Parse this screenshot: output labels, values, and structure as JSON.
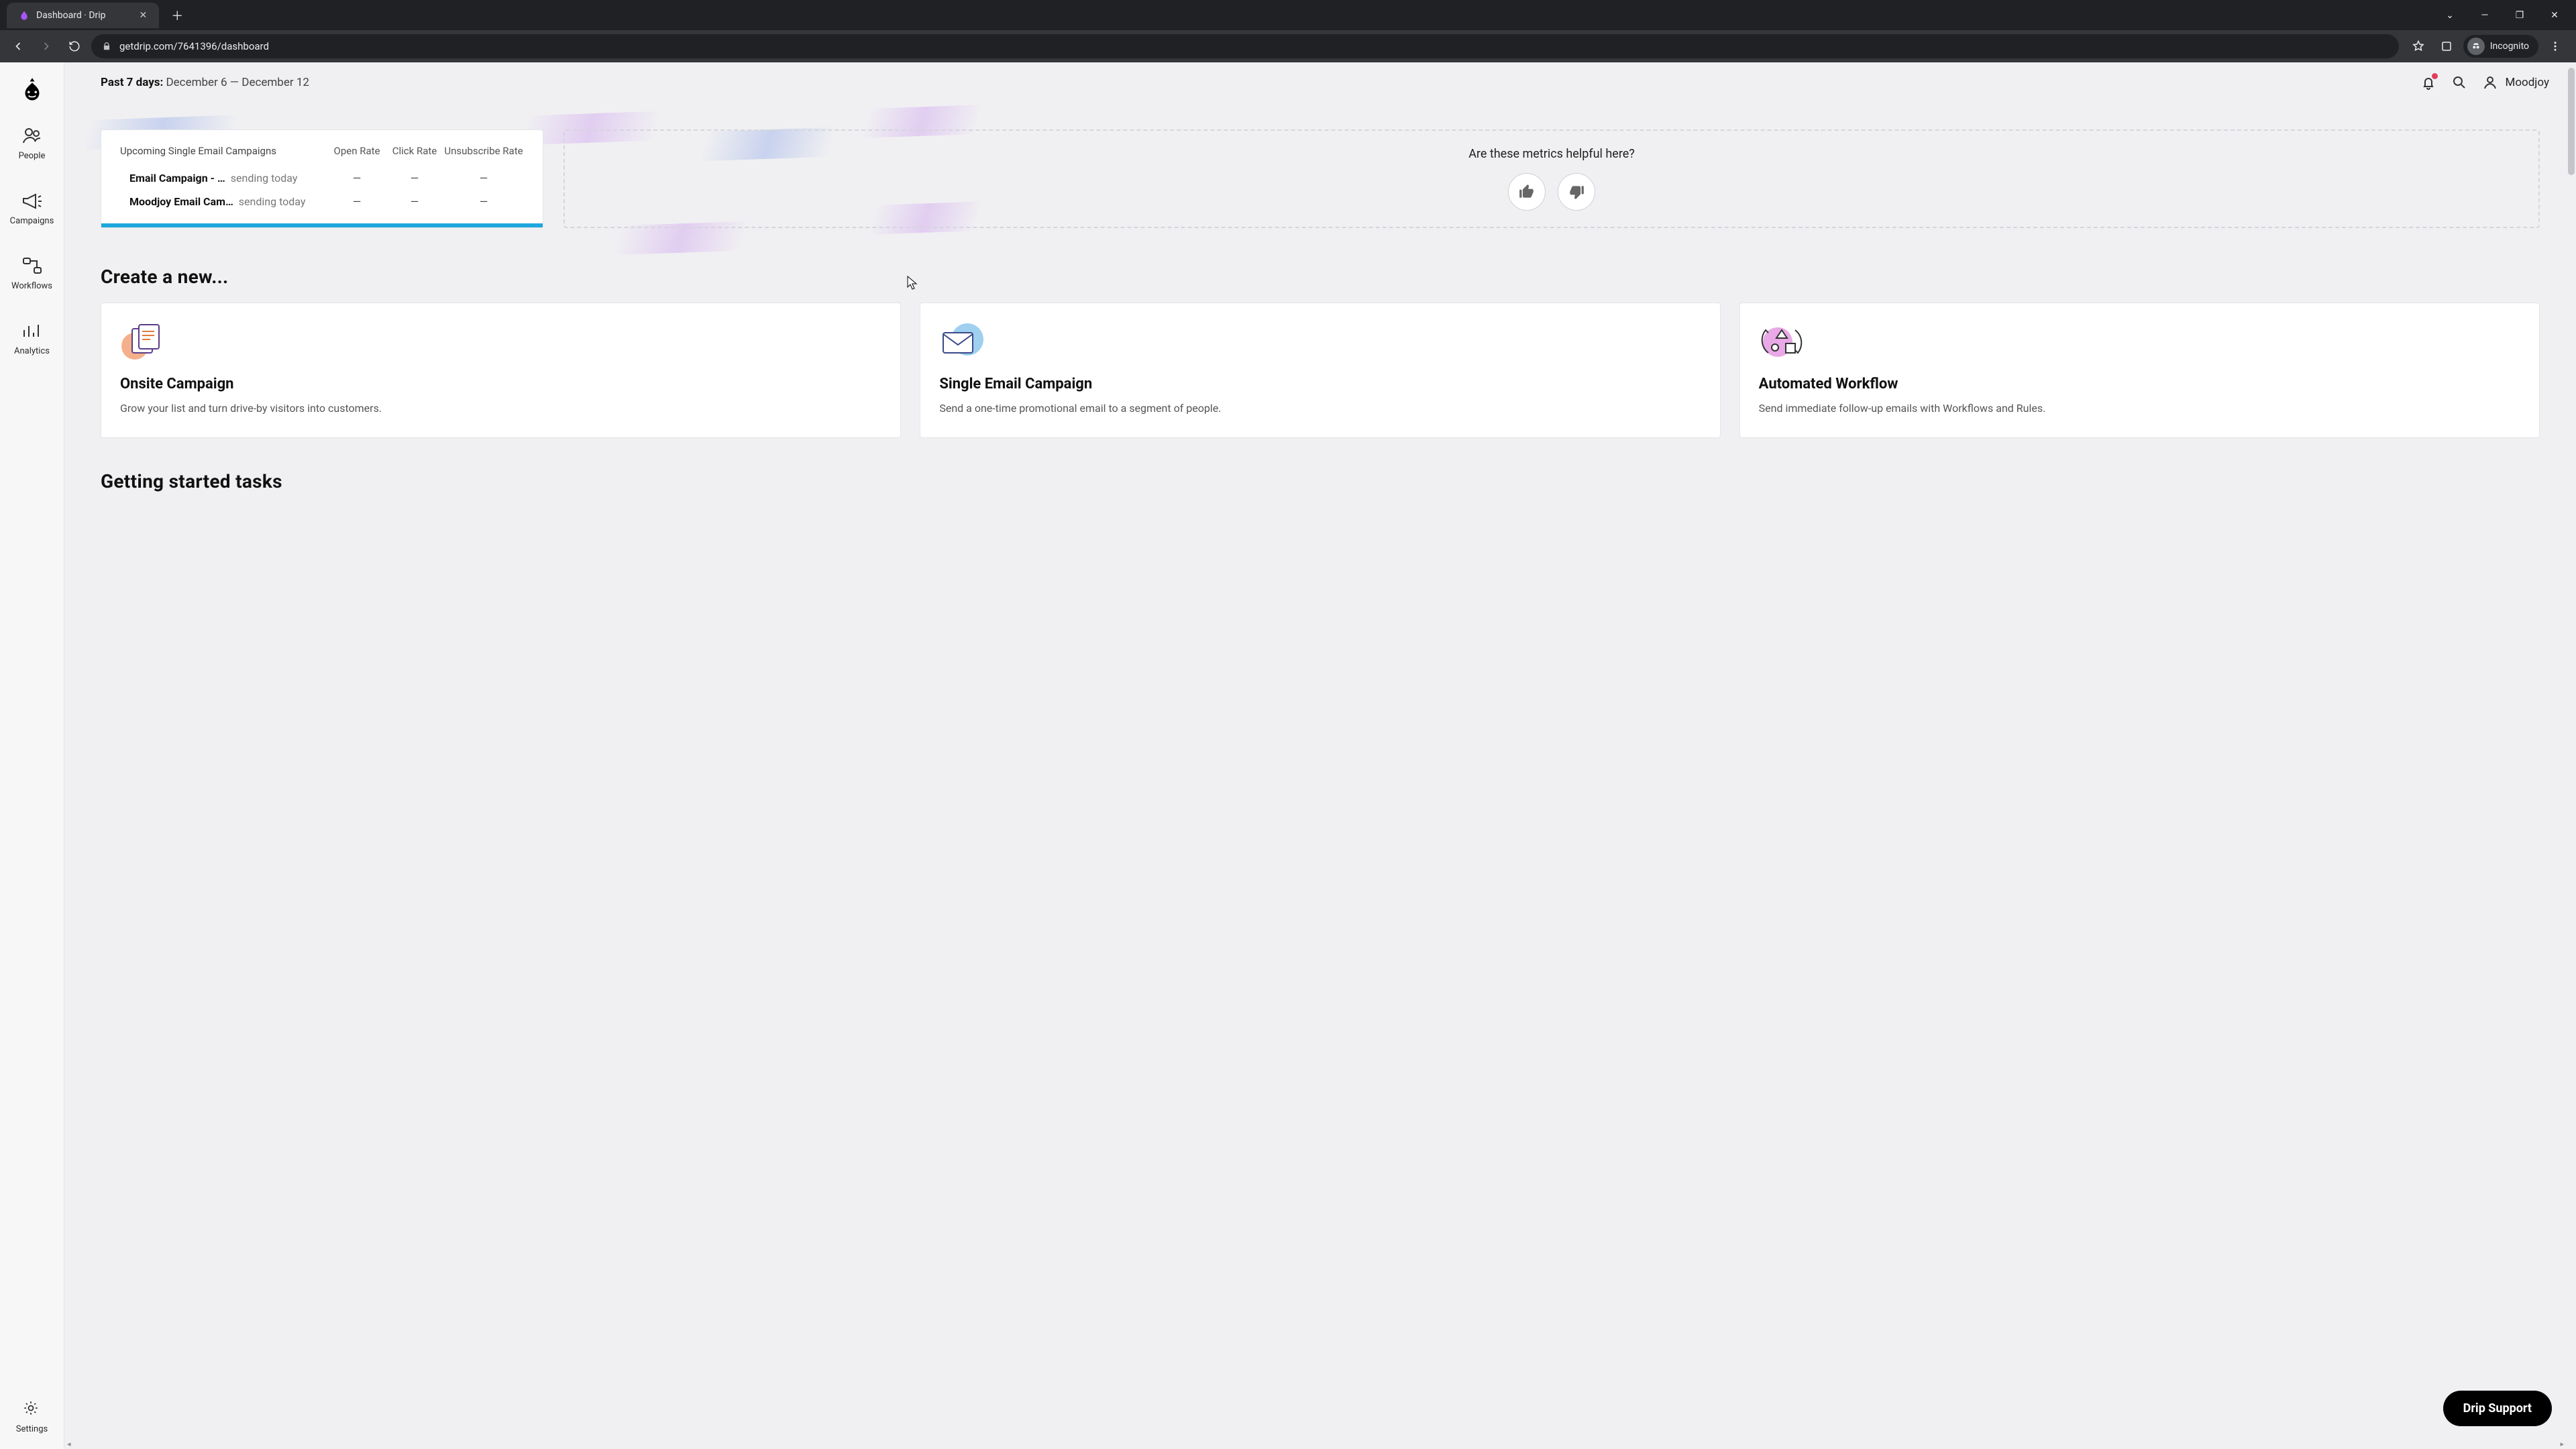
{
  "browser": {
    "tab_title": "Dashboard · Drip",
    "url": "getdrip.com/7641396/dashboard",
    "incognito_label": "Incognito"
  },
  "topbar": {
    "range_label": "Past 7 days:",
    "range_value": "December 6 — December 12",
    "user_name": "Moodjoy"
  },
  "sidebar": {
    "items": [
      {
        "label": "People"
      },
      {
        "label": "Campaigns"
      },
      {
        "label": "Workflows"
      },
      {
        "label": "Analytics"
      }
    ],
    "settings_label": "Settings"
  },
  "campaigns": {
    "title": "Upcoming Single Email Campaigns",
    "cols": {
      "open": "Open Rate",
      "click": "Click Rate",
      "unsub": "Unsubscribe Rate"
    },
    "rows": [
      {
        "name": "Email Campaign - …",
        "status": "sending today",
        "open": "—",
        "click": "—",
        "unsub": "—"
      },
      {
        "name": "Moodjoy Email Cam…",
        "status": "sending today",
        "open": "—",
        "click": "—",
        "unsub": "—"
      }
    ]
  },
  "feedback": {
    "question": "Are these metrics helpful here?"
  },
  "create": {
    "heading": "Create a new...",
    "cards": [
      {
        "title": "Onsite Campaign",
        "desc": "Grow your list and turn drive-by visitors into customers."
      },
      {
        "title": "Single Email Campaign",
        "desc": "Send a one-time promotional email to a segment of people."
      },
      {
        "title": "Automated Workflow",
        "desc": "Send immediate follow-up emails with Workflows and Rules."
      }
    ]
  },
  "tasks": {
    "heading": "Getting started tasks"
  },
  "support": {
    "label": "Drip Support"
  }
}
